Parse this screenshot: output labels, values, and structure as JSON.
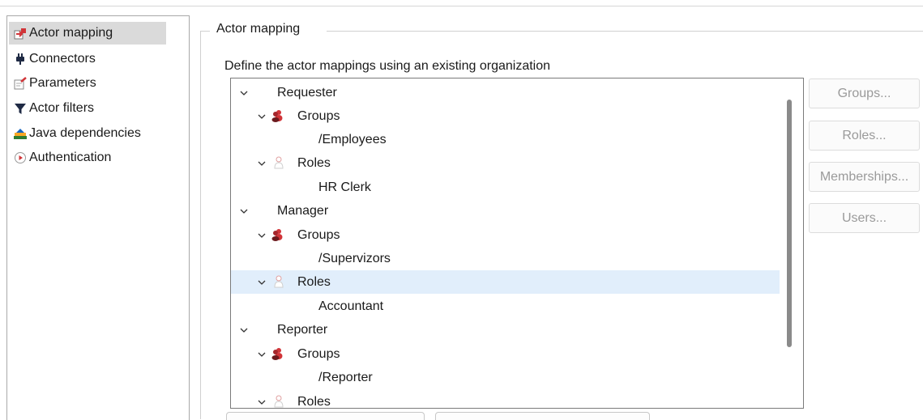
{
  "nav": {
    "items": [
      {
        "label": "Actor mapping",
        "icon": "actor-mapping-icon",
        "selected": true
      },
      {
        "label": "Connectors",
        "icon": "connector-plug-icon",
        "selected": false
      },
      {
        "label": "Parameters",
        "icon": "parameters-icon",
        "selected": false
      },
      {
        "label": "Actor filters",
        "icon": "filter-funnel-icon",
        "selected": false
      },
      {
        "label": "Java dependencies",
        "icon": "java-dependencies-icon",
        "selected": false
      },
      {
        "label": "Authentication",
        "icon": "authentication-icon",
        "selected": false
      }
    ]
  },
  "group": {
    "title": "Actor mapping",
    "description": "Define the actor mappings using an existing organization"
  },
  "tree": {
    "rows": [
      {
        "label": "Requester",
        "level": 0,
        "kind": "actor"
      },
      {
        "label": "Groups",
        "level": 1,
        "kind": "groups"
      },
      {
        "label": "/Employees",
        "level": 2,
        "kind": "value"
      },
      {
        "label": "Roles",
        "level": 1,
        "kind": "roles"
      },
      {
        "label": "HR Clerk",
        "level": 2,
        "kind": "value"
      },
      {
        "label": "Manager",
        "level": 0,
        "kind": "actor"
      },
      {
        "label": "Groups",
        "level": 1,
        "kind": "groups"
      },
      {
        "label": "/Supervizors",
        "level": 2,
        "kind": "value"
      },
      {
        "label": "Roles",
        "level": 1,
        "kind": "roles",
        "selected": true
      },
      {
        "label": "Accountant",
        "level": 2,
        "kind": "value"
      },
      {
        "label": "Reporter",
        "level": 0,
        "kind": "actor"
      },
      {
        "label": "Groups",
        "level": 1,
        "kind": "groups"
      },
      {
        "label": "/Reporter",
        "level": 2,
        "kind": "value"
      },
      {
        "label": "Roles",
        "level": 1,
        "kind": "roles"
      }
    ]
  },
  "buttons": {
    "groups": "Groups...",
    "roles": "Roles...",
    "memberships": "Memberships...",
    "users": "Users..."
  },
  "colors": {
    "selection": "#e1eefb",
    "nav_selection": "#dadada",
    "group_icon": "#d13438",
    "disabled_text": "#9a9a9a"
  }
}
